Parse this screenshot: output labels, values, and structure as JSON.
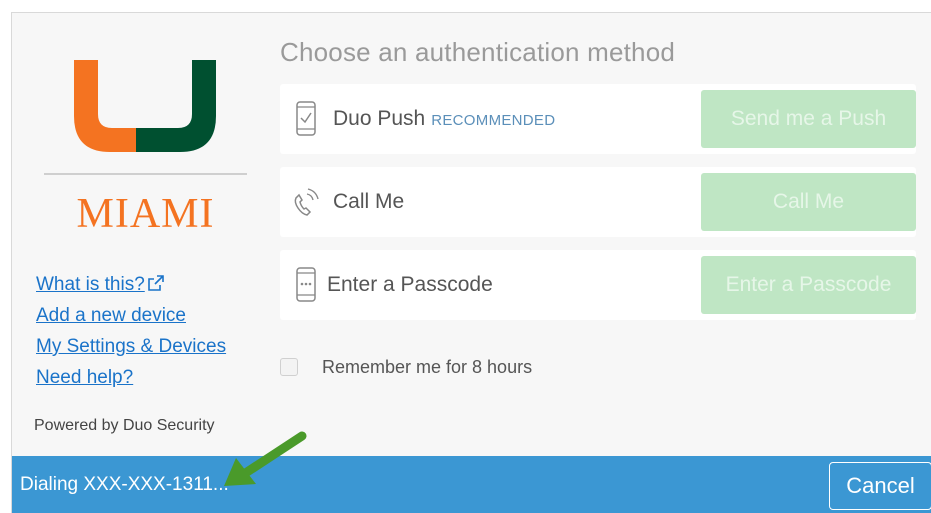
{
  "brand": {
    "wordmark": "MIAMI",
    "colors": {
      "orange": "#f47321",
      "green": "#005030"
    }
  },
  "sidebar": {
    "links": [
      {
        "label": "What is this?",
        "icon": "external-link-icon"
      },
      {
        "label": "Add a new device"
      },
      {
        "label": "My Settings & Devices"
      },
      {
        "label": "Need help?"
      }
    ],
    "powered_by": "Powered by Duo Security"
  },
  "main": {
    "title": "Choose an authentication method",
    "methods": [
      {
        "icon": "phone-check-icon",
        "label": "Duo Push",
        "badge": "RECOMMENDED",
        "button": "Send me a Push"
      },
      {
        "icon": "phone-call-icon",
        "label": "Call Me",
        "button": "Call Me"
      },
      {
        "icon": "phone-passcode-icon",
        "label": "Enter a Passcode",
        "button": "Enter a Passcode"
      }
    ],
    "remember_label": "Remember me for 8 hours",
    "remember_checked": false
  },
  "status_bar": {
    "text": "Dialing XXX-XXX-1311...",
    "cancel_label": "Cancel",
    "color": "#3b97d3"
  },
  "annotation": {
    "icon": "green-arrow-icon",
    "color": "#4a9a2a"
  }
}
